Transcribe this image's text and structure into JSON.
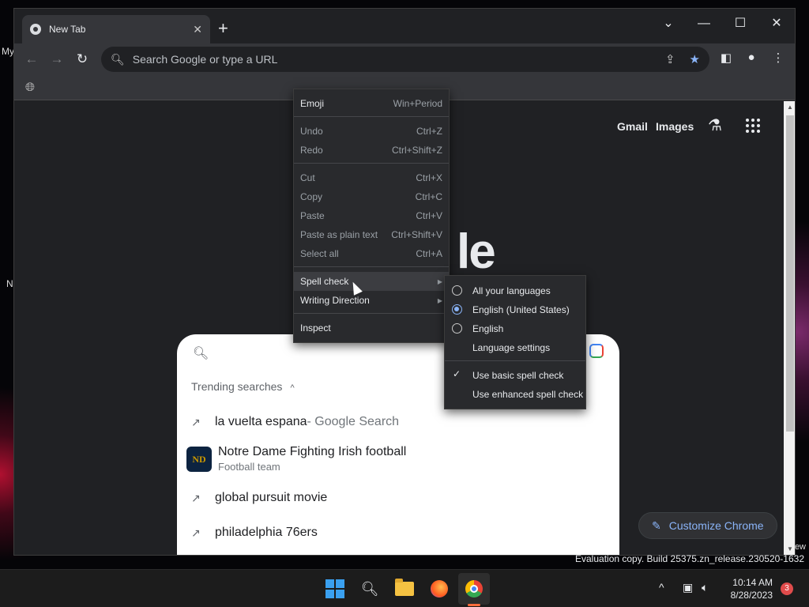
{
  "desktop": {
    "labels": [
      "My",
      "N"
    ]
  },
  "tab": {
    "title": "New Tab"
  },
  "omnibox": {
    "placeholder": "Search Google or type a URL"
  },
  "page": {
    "top_links": {
      "gmail": "Gmail",
      "images": "Images"
    },
    "logo_fragment": "le",
    "trending": {
      "header": "Trending searches",
      "items": [
        {
          "text": "la vuelta espana",
          "suffix": " - Google Search"
        },
        {
          "title": "Notre Dame Fighting Irish football",
          "subtitle": "Football team",
          "logo": "ND"
        },
        {
          "text": "global pursuit movie"
        },
        {
          "text": "philadelphia 76ers"
        }
      ]
    },
    "customize_label": "Customize Chrome"
  },
  "context_menu": {
    "items": [
      {
        "label": "Emoji",
        "shortcut": "Win+Period"
      },
      {
        "label": "Undo",
        "shortcut": "Ctrl+Z"
      },
      {
        "label": "Redo",
        "shortcut": "Ctrl+Shift+Z"
      },
      {
        "label": "Cut",
        "shortcut": "Ctrl+X"
      },
      {
        "label": "Copy",
        "shortcut": "Ctrl+C"
      },
      {
        "label": "Paste",
        "shortcut": "Ctrl+V"
      },
      {
        "label": "Paste as plain text",
        "shortcut": "Ctrl+Shift+V"
      },
      {
        "label": "Select all",
        "shortcut": "Ctrl+A"
      },
      {
        "label": "Spell check"
      },
      {
        "label": "Writing Direction"
      },
      {
        "label": "Inspect"
      }
    ]
  },
  "spell_submenu": {
    "items": [
      {
        "label": "All your languages",
        "type": "radio",
        "selected": false
      },
      {
        "label": "English (United States)",
        "type": "radio",
        "selected": true
      },
      {
        "label": "English",
        "type": "radio",
        "selected": false
      },
      {
        "label": "Language settings",
        "type": "action"
      },
      {
        "label": "Use basic spell check",
        "type": "check",
        "checked": true
      },
      {
        "label": "Use enhanced spell check",
        "type": "action"
      }
    ]
  },
  "watermark": "Evaluation copy. Build 25375.zn_release.230520-1632",
  "watermark_edge": "ew",
  "taskbar": {
    "time": "10:14 AM",
    "date": "8/28/2023",
    "notification_count": "3"
  },
  "colors": {
    "accent": "#8ab4f8",
    "menu_bg": "#292a2d",
    "page_bg": "#202124"
  }
}
